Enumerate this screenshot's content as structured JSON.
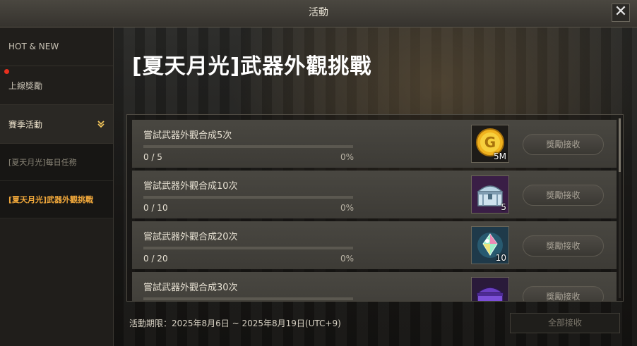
{
  "window": {
    "title": "活動",
    "close_glyph": "✕"
  },
  "sidebar": {
    "items": [
      {
        "label": "HOT & NEW"
      },
      {
        "label": "上線獎勵",
        "has_notification": true
      },
      {
        "label": "賽季活動",
        "expanded": true
      }
    ],
    "subitems": [
      {
        "label": "[夏天月光]每日任務"
      },
      {
        "label": "[夏天月光]武器外觀挑戰",
        "selected": true
      }
    ]
  },
  "main": {
    "title": "[夏天月光]武器外觀挑戰",
    "missions": [
      {
        "label": "嘗試武器外觀合成5次",
        "count": "0 / 5",
        "progress": "0%",
        "progress_value": 0,
        "reward_icon": "gold-coin-icon",
        "reward_qty": "5M",
        "button": "獎勵接收"
      },
      {
        "label": "嘗試武器外觀合成10次",
        "count": "0 / 10",
        "progress": "0%",
        "progress_value": 0,
        "reward_icon": "silver-chest-icon",
        "reward_qty": "5",
        "button": "獎勵接收"
      },
      {
        "label": "嘗試武器外觀合成20次",
        "count": "0 / 20",
        "progress": "0%",
        "progress_value": 0,
        "reward_icon": "crystal-icon",
        "reward_qty": "10",
        "button": "獎勵接收"
      },
      {
        "label": "嘗試武器外觀合成30次",
        "count": "",
        "progress": "",
        "progress_value": 0,
        "reward_icon": "purple-chest-icon",
        "reward_qty": "",
        "button": "獎勵接收"
      }
    ],
    "period": "活動期限：2025年8月6日 ~ 2025年8月19日(UTC+9)",
    "claim_all": "全部接收"
  },
  "colors": {
    "accent": "#f2a93b",
    "progress": "#d3a33c",
    "notification": "#e8301e"
  }
}
